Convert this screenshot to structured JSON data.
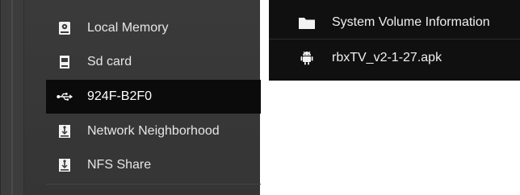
{
  "sidebar": {
    "items": [
      {
        "label": "Local Memory",
        "icon": "local-memory-icon"
      },
      {
        "label": "Sd card",
        "icon": "sd-card-icon"
      },
      {
        "label": "924F-B2F0",
        "icon": "usb-icon",
        "selected": true
      },
      {
        "label": "Network Neighborhood",
        "icon": "network-share-icon"
      },
      {
        "label": "NFS Share",
        "icon": "nfs-share-icon"
      }
    ]
  },
  "files": {
    "items": [
      {
        "label": "System Volume Information",
        "icon": "folder-icon"
      },
      {
        "label": "rbxTV_v2-1-27.apk",
        "icon": "android-icon"
      }
    ]
  },
  "colors": {
    "sidebar_bg": "#383838",
    "selected_bg": "#0b0b0b",
    "file_panel_bg": "#101010",
    "text": "#e6e6e6"
  }
}
